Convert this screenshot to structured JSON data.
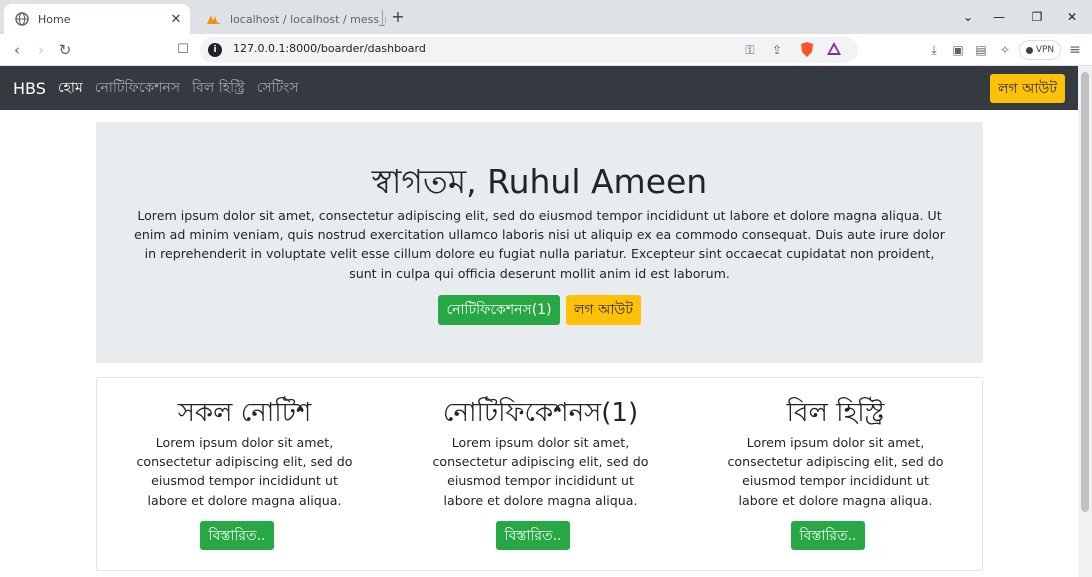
{
  "browser": {
    "tabs": [
      {
        "title": "Home",
        "active": true
      },
      {
        "title": "localhost / localhost / mess_manag",
        "active": false
      }
    ],
    "url": "127.0.0.1:8000/boarder/dashboard",
    "vpn_label": "VPN"
  },
  "navbar": {
    "brand": "HBS",
    "links": [
      "হোম",
      "নোটিফিকেশনস",
      "বিল হিস্ট্রি",
      "সেটিংস"
    ],
    "logout": "লগ আউট"
  },
  "jumbotron": {
    "title": "স্বাগতম, Ruhul Ameen",
    "text": "Lorem ipsum dolor sit amet, consectetur adipiscing elit, sed do eiusmod tempor incididunt ut labore et dolore magna aliqua. Ut enim ad minim veniam, quis nostrud exercitation ullamco laboris nisi ut aliquip ex ea commodo consequat. Duis aute irure dolor in reprehenderit in voluptate velit esse cillum dolore eu fugiat nulla pariatur. Excepteur sint occaecat cupidatat non proident, sunt in culpa qui officia deserunt mollit anim id est laborum.",
    "notifications_button": "নোটিফিকেশনস(1)",
    "logout_button": "লগ আউট"
  },
  "cards": [
    {
      "title": "সকল নোটিশ",
      "text": "Lorem ipsum dolor sit amet, consectetur adipiscing elit, sed do eiusmod tempor incididunt ut labore et dolore magna aliqua.",
      "button": "বিস্তারিত.."
    },
    {
      "title": "নোটিফিকেশনস(1)",
      "text": "Lorem ipsum dolor sit amet, consectetur adipiscing elit, sed do eiusmod tempor incididunt ut labore et dolore magna aliqua.",
      "button": "বিস্তারিত.."
    },
    {
      "title": "বিল হিস্ট্রি",
      "text": "Lorem ipsum dolor sit amet, consectetur adipiscing elit, sed do eiusmod tempor incididunt ut labore et dolore magna aliqua.",
      "button": "বিস্তারিত.."
    }
  ],
  "colors": {
    "navbar_bg": "#343a40",
    "jumbotron_bg": "#e9ecef",
    "success": "#28a745",
    "warning": "#ffc107"
  }
}
